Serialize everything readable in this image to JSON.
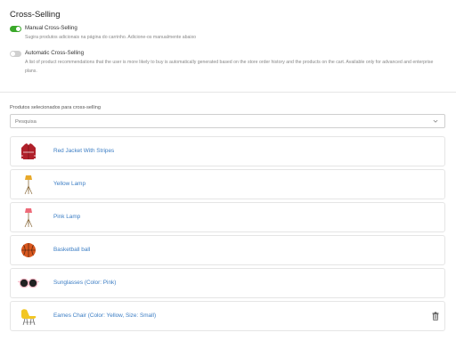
{
  "section": {
    "title": "Cross-Selling"
  },
  "manual": {
    "label": "Manual Cross-Selling",
    "description": "Sugira produtos adicionais na página do carrinho. Adicione-os manualmente abaixo",
    "enabled": true
  },
  "automatic": {
    "label": "Automatic Cross-Selling",
    "description": "A list of product recommendations that the user is more likely to buy is automatically generated based on the store order history and the products on the cart. Available only for advanced and enterprise plans.",
    "enabled": false
  },
  "selected": {
    "label": "Produtos selecionados para cross-selling",
    "search_placeholder": "Pesquisa"
  },
  "products": [
    {
      "name": "Red Jacket With Stripes",
      "icon": "jacket-icon"
    },
    {
      "name": "Yellow Lamp",
      "icon": "floor-lamp-icon"
    },
    {
      "name": "Pink Lamp",
      "icon": "floor-lamp-icon"
    },
    {
      "name": "Basketball ball",
      "icon": "basketball-icon"
    },
    {
      "name": "Sunglasses (Color: Pink)",
      "icon": "sunglasses-icon"
    },
    {
      "name": "Eames Chair (Color: Yellow, Size: Small)",
      "icon": "chair-icon"
    }
  ],
  "colors": {
    "toggle_on": "#3aa82a",
    "toggle_off": "#d0d0d0",
    "link": "#3b7dc4"
  }
}
